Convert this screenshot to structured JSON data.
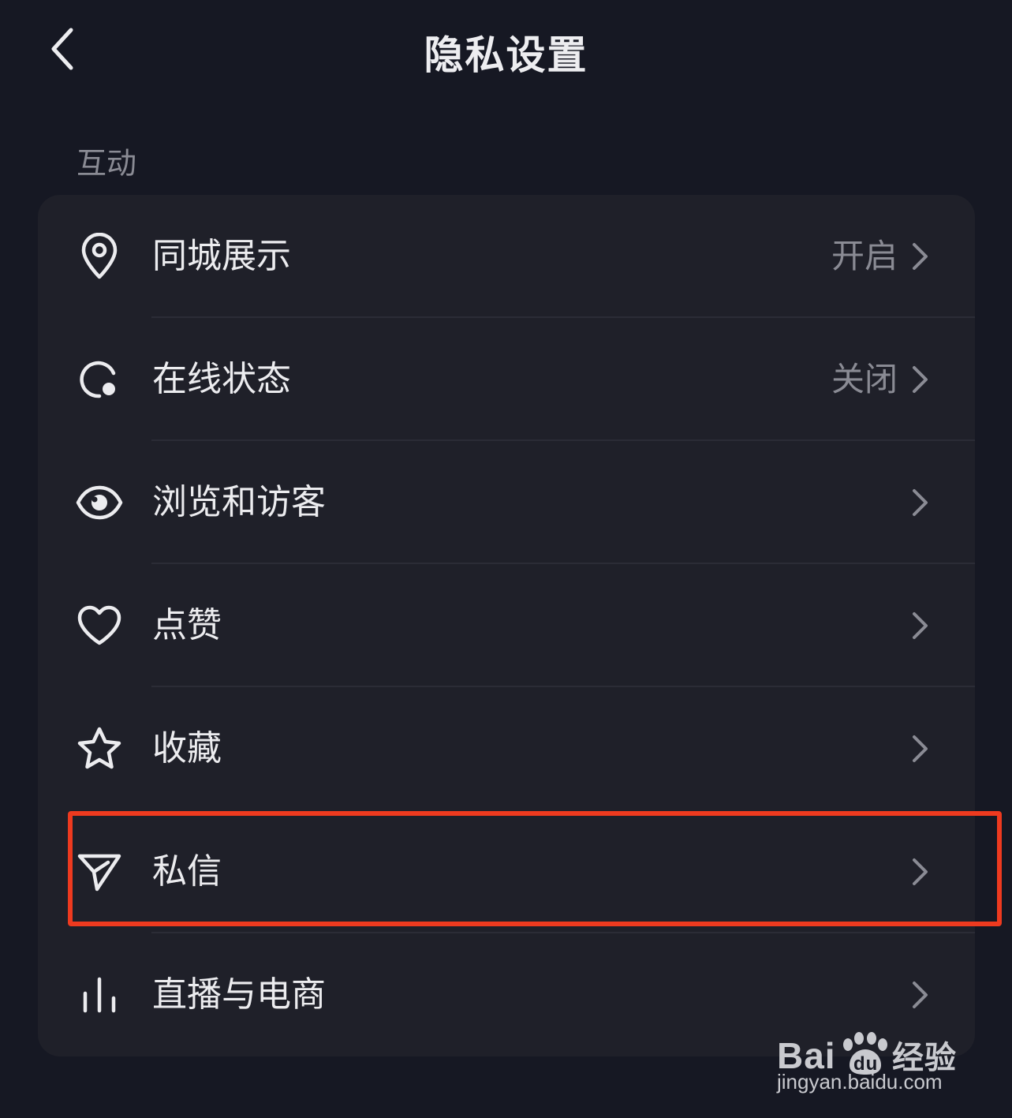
{
  "header": {
    "title": "隐私设置",
    "back_icon": "chevron-left-icon"
  },
  "section": {
    "label": "互动"
  },
  "items": [
    {
      "id": "city",
      "label": "同城展示",
      "value": "开启",
      "icon": "location-pin-icon"
    },
    {
      "id": "online",
      "label": "在线状态",
      "value": "关闭",
      "icon": "online-status-icon"
    },
    {
      "id": "visitors",
      "label": "浏览和访客",
      "value": "",
      "icon": "eye-icon"
    },
    {
      "id": "likes",
      "label": "点赞",
      "value": "",
      "icon": "heart-icon"
    },
    {
      "id": "favorites",
      "label": "收藏",
      "value": "",
      "icon": "star-icon"
    },
    {
      "id": "messages",
      "label": "私信",
      "value": "",
      "icon": "paper-plane-icon",
      "highlighted": true
    },
    {
      "id": "live",
      "label": "直播与电商",
      "value": "",
      "icon": "bars-icon"
    }
  ],
  "colors": {
    "background": "#161823",
    "card": "#1f2029",
    "highlight": "#ee3a1f",
    "secondary_text": "#8a8b94"
  },
  "watermark": {
    "logo": "Bai du 经验",
    "url": "jingyan.baidu.com"
  }
}
